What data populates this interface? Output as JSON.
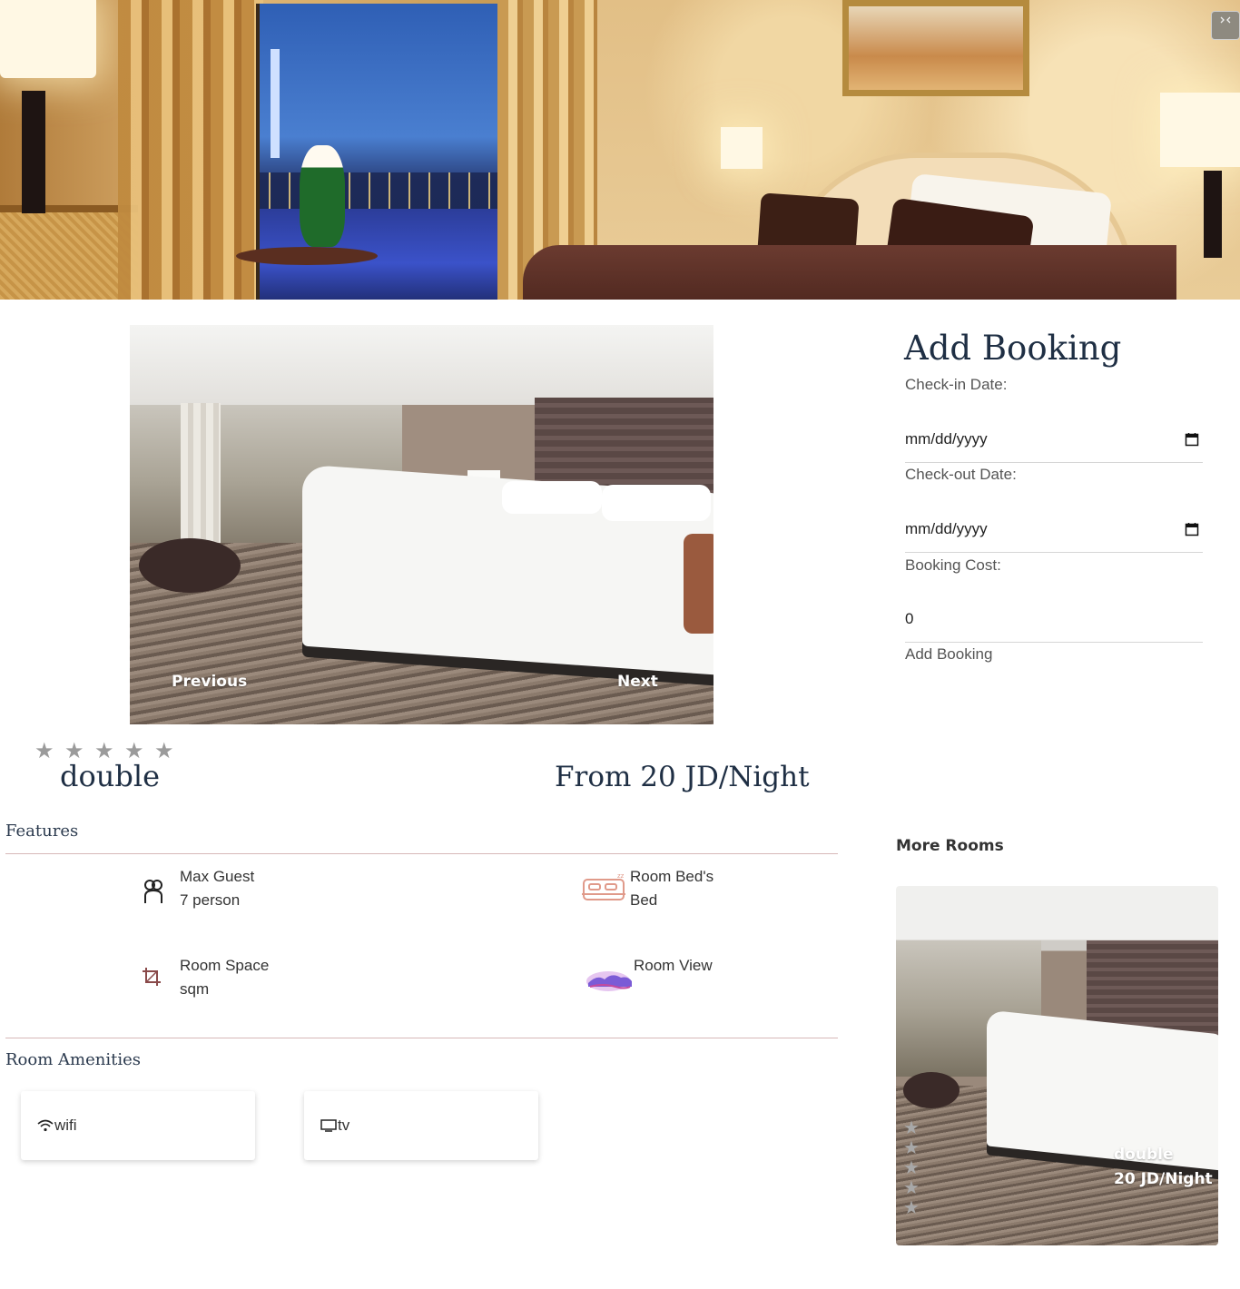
{
  "hero": {
    "corner_button_icon": "expand-icon"
  },
  "carousel": {
    "previous_label": "Previous",
    "next_label": "Next"
  },
  "room": {
    "rating_stars": 5,
    "name": "double",
    "price_title": "From 20 JD/Night"
  },
  "features": {
    "title": "Features",
    "items": [
      {
        "icon": "person-icon",
        "label": "Max Guest",
        "value": "7 person"
      },
      {
        "icon": "bed-icon",
        "label": "Room Bed's",
        "value": "Bed"
      },
      {
        "icon": "crop-icon",
        "label": "Room Space",
        "value": "sqm"
      },
      {
        "icon": "landscape-icon",
        "label": "Room View",
        "value": ""
      }
    ]
  },
  "amenities": {
    "title": "Room Amenities",
    "items": [
      {
        "icon": "wifi-icon",
        "label": "wifi"
      },
      {
        "icon": "tv-icon",
        "label": "tv"
      }
    ]
  },
  "booking": {
    "title": "Add Booking",
    "checkin_label": "Check-in Date:",
    "checkin_placeholder": "mm/dd/yyyy",
    "checkout_label": "Check-out Date:",
    "checkout_placeholder": "mm/dd/yyyy",
    "cost_label": "Booking Cost:",
    "cost_value": "0",
    "submit_label": "Add Booking"
  },
  "more_rooms": {
    "title": "More Rooms",
    "cards": [
      {
        "name": "double",
        "price": "20 JD/Night",
        "rating_stars": 5
      }
    ]
  },
  "colors": {
    "heading": "#1f2f44",
    "divider": "#d7b8b8",
    "star": "#9b9b9b",
    "bed_icon": "#e09a8a"
  }
}
